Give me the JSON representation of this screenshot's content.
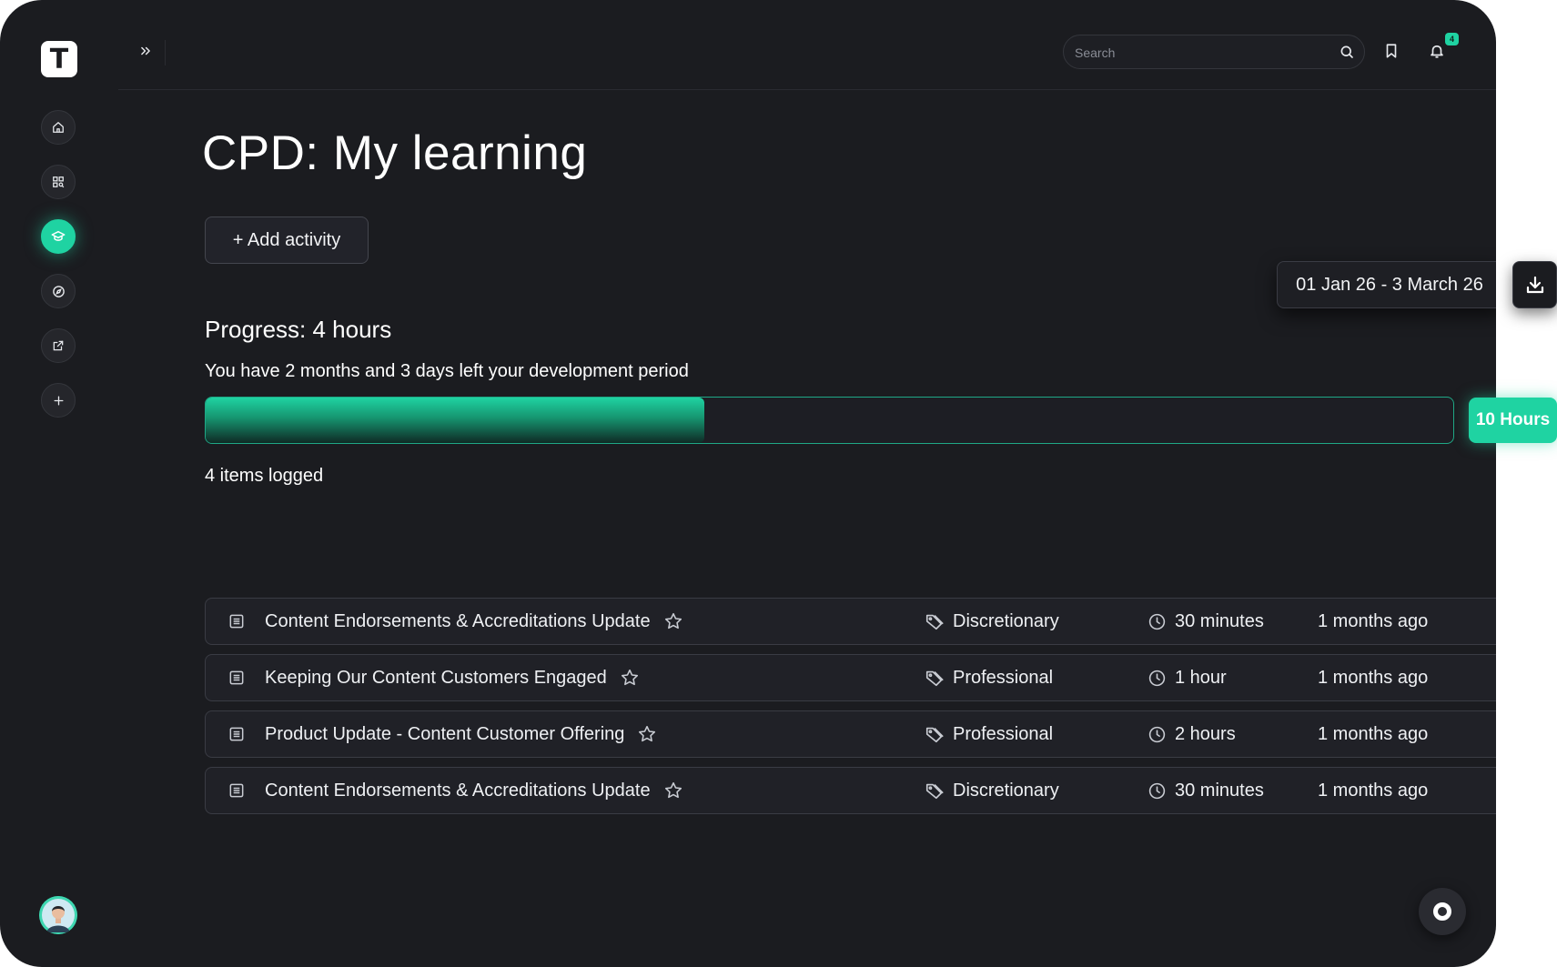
{
  "app": {
    "logo_letter": "T",
    "accent_color": "#1fd3a2",
    "background_color": "#1b1c20"
  },
  "sidebar": {
    "items": [
      {
        "icon": "home-icon"
      },
      {
        "icon": "library-icon"
      },
      {
        "icon": "graduation-cap-icon",
        "active": true
      },
      {
        "icon": "compass-icon"
      },
      {
        "icon": "external-link-icon"
      },
      {
        "icon": "plus-icon"
      }
    ]
  },
  "header": {
    "search_placeholder": "Search",
    "notification_count": "4"
  },
  "main": {
    "title": "CPD: My learning",
    "add_button_label": "+ Add activity",
    "date_range": "01 Jan 26 - 3 March 26",
    "progress_title": "Progress: 4 hours",
    "progress_subtitle": "You have 2 months and 3 days left your development period",
    "progress_fraction": 0.4,
    "target_label": "10 Hours",
    "items_logged": "4 items logged"
  },
  "activities": [
    {
      "title": "Content Endorsements & Accreditations Update",
      "category": "Discretionary",
      "duration": "30 minutes",
      "ago": "1 months ago"
    },
    {
      "title": "Keeping Our Content Customers Engaged",
      "category": "Professional",
      "duration": "1 hour",
      "ago": "1 months ago"
    },
    {
      "title": "Product Update - Content Customer Offering",
      "category": "Professional",
      "duration": "2 hours",
      "ago": "1 months ago"
    },
    {
      "title": "Content Endorsements & Accreditations Update",
      "category": "Discretionary",
      "duration": "30 minutes",
      "ago": "1 months ago"
    }
  ]
}
